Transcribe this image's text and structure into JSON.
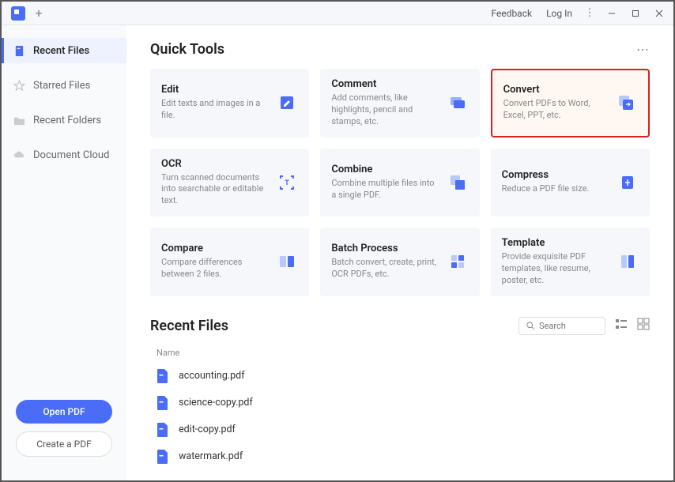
{
  "titlebar": {
    "feedback": "Feedback",
    "login": "Log In"
  },
  "sidebar": {
    "items": [
      {
        "label": "Recent Files"
      },
      {
        "label": "Starred Files"
      },
      {
        "label": "Recent Folders"
      },
      {
        "label": "Document Cloud"
      }
    ],
    "open_label": "Open PDF",
    "create_label": "Create a PDF"
  },
  "quick_tools": {
    "title": "Quick Tools",
    "cards": [
      {
        "title": "Edit",
        "desc": "Edit texts and images in a file."
      },
      {
        "title": "Comment",
        "desc": "Add comments, like highlights, pencil and stamps, etc."
      },
      {
        "title": "Convert",
        "desc": "Convert PDFs to Word, Excel, PPT, etc."
      },
      {
        "title": "OCR",
        "desc": "Turn scanned documents into searchable or editable text."
      },
      {
        "title": "Combine",
        "desc": "Combine multiple files into a single PDF."
      },
      {
        "title": "Compress",
        "desc": "Reduce a PDF file size."
      },
      {
        "title": "Compare",
        "desc": "Compare differences between 2 files."
      },
      {
        "title": "Batch Process",
        "desc": "Batch convert, create, print, OCR PDFs, etc."
      },
      {
        "title": "Template",
        "desc": "Provide exquisite PDF templates, like resume, poster, etc."
      }
    ]
  },
  "recent": {
    "title": "Recent Files",
    "search_placeholder": "Search",
    "col_name": "Name",
    "files": [
      {
        "name": "accounting.pdf"
      },
      {
        "name": "science-copy.pdf"
      },
      {
        "name": "edit-copy.pdf"
      },
      {
        "name": "watermark.pdf"
      }
    ]
  }
}
